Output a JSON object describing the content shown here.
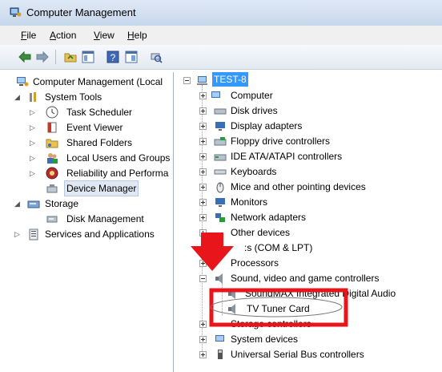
{
  "window": {
    "title": "Computer Management"
  },
  "menu": [
    "File",
    "Action",
    "View",
    "Help"
  ],
  "left_tree": {
    "root": "Computer Management (Local",
    "system_tools": "System Tools",
    "task_scheduler": "Task Scheduler",
    "event_viewer": "Event Viewer",
    "shared_folders": "Shared Folders",
    "local_users": "Local Users and Groups",
    "reliability": "Reliability and Performa",
    "device_manager": "Device Manager",
    "storage": "Storage",
    "disk_management": "Disk Management",
    "services": "Services and Applications"
  },
  "right_tree": {
    "root": "TEST-8",
    "items": {
      "computer": "Computer",
      "disk": "Disk drives",
      "display": "Display adapters",
      "floppy": "Floppy drive controllers",
      "ide": "IDE ATA/ATAPI controllers",
      "keyboards": "Keyboards",
      "mice": "Mice and other pointing devices",
      "monitors": "Monitors",
      "network": "Network adapters",
      "other": "Other devices",
      "ports": ":s (COM & LPT)",
      "processors": "Processors",
      "sound": "Sound, video and game controllers",
      "soundmax": "SoundMAX Integrated Digital Audio",
      "tv": "TV Tuner Card",
      "storage_ctl": "Storage controllers",
      "system": "System devices",
      "usb": "Universal Serial Bus controllers"
    }
  },
  "colors": {
    "annotation_red": "#e8151b",
    "selection_blue": "#3399ff"
  }
}
